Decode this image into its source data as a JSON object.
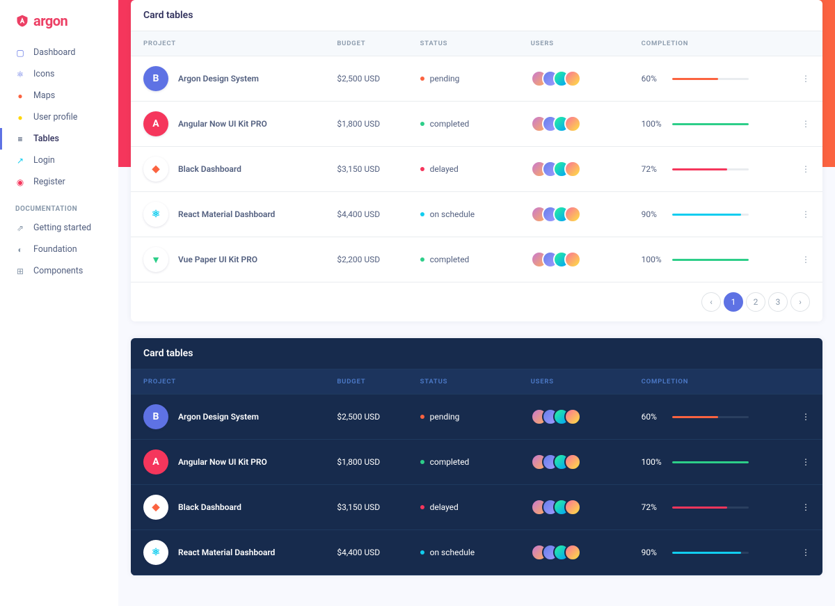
{
  "brand": {
    "name": "argon"
  },
  "sidebar": {
    "items": [
      {
        "label": "Dashboard",
        "icon": "dashboard-icon",
        "color": "#5e72e4"
      },
      {
        "label": "Icons",
        "icon": "atom-icon",
        "color": "#5e72e4"
      },
      {
        "label": "Maps",
        "icon": "pin-icon",
        "color": "#fb6340"
      },
      {
        "label": "User profile",
        "icon": "user-icon",
        "color": "#ffd600"
      },
      {
        "label": "Tables",
        "icon": "list-icon",
        "color": "#172b4d",
        "active": true
      },
      {
        "label": "Login",
        "icon": "key-icon",
        "color": "#11cdef"
      },
      {
        "label": "Register",
        "icon": "circle-icon",
        "color": "#f5365c"
      }
    ],
    "doc_heading": "DOCUMENTATION",
    "docs": [
      {
        "label": "Getting started",
        "icon": "rocket-icon"
      },
      {
        "label": "Foundation",
        "icon": "palette-icon"
      },
      {
        "label": "Components",
        "icon": "grid-icon"
      }
    ]
  },
  "tables": {
    "light": {
      "title": "Card tables",
      "columns": [
        "PROJECT",
        "BUDGET",
        "STATUS",
        "USERS",
        "COMPLETION",
        ""
      ],
      "rows": [
        {
          "name": "Argon Design System",
          "budget": "$2,500 USD",
          "status": "pending",
          "status_color": "#fb6340",
          "completion": 60,
          "bar_color": "#fb6340",
          "logo_bg": "#5e72e4",
          "logo_text": "B",
          "logo_fg": "#fff"
        },
        {
          "name": "Angular Now UI Kit PRO",
          "budget": "$1,800 USD",
          "status": "completed",
          "status_color": "#2dce89",
          "completion": 100,
          "bar_color": "#2dce89",
          "logo_bg": "#f5365c",
          "logo_text": "A",
          "logo_fg": "#fff"
        },
        {
          "name": "Black Dashboard",
          "budget": "$3,150 USD",
          "status": "delayed",
          "status_color": "#f5365c",
          "completion": 72,
          "bar_color": "#f5365c",
          "logo_bg": "#fff",
          "logo_text": "◆",
          "logo_fg": "#fb6340"
        },
        {
          "name": "React Material Dashboard",
          "budget": "$4,400 USD",
          "status": "on schedule",
          "status_color": "#11cdef",
          "completion": 90,
          "bar_color": "#11cdef",
          "logo_bg": "#fff",
          "logo_text": "⚛",
          "logo_fg": "#11cdef"
        },
        {
          "name": "Vue Paper UI Kit PRO",
          "budget": "$2,200 USD",
          "status": "completed",
          "status_color": "#2dce89",
          "completion": 100,
          "bar_color": "#2dce89",
          "logo_bg": "#fff",
          "logo_text": "▼",
          "logo_fg": "#2dce89"
        }
      ],
      "pagination": {
        "pages": [
          "1",
          "2",
          "3"
        ],
        "active": 1
      }
    },
    "dark": {
      "title": "Card tables",
      "columns": [
        "PROJECT",
        "BUDGET",
        "STATUS",
        "USERS",
        "COMPLETION",
        ""
      ],
      "rows": [
        {
          "name": "Argon Design System",
          "budget": "$2,500 USD",
          "status": "pending",
          "status_color": "#fb6340",
          "completion": 60,
          "bar_color": "#fb6340",
          "logo_bg": "#5e72e4",
          "logo_text": "B",
          "logo_fg": "#fff"
        },
        {
          "name": "Angular Now UI Kit PRO",
          "budget": "$1,800 USD",
          "status": "completed",
          "status_color": "#2dce89",
          "completion": 100,
          "bar_color": "#2dce89",
          "logo_bg": "#f5365c",
          "logo_text": "A",
          "logo_fg": "#fff"
        },
        {
          "name": "Black Dashboard",
          "budget": "$3,150 USD",
          "status": "delayed",
          "status_color": "#f5365c",
          "completion": 72,
          "bar_color": "#f5365c",
          "logo_bg": "#fff",
          "logo_text": "◆",
          "logo_fg": "#fb6340"
        },
        {
          "name": "React Material Dashboard",
          "budget": "$4,400 USD",
          "status": "on schedule",
          "status_color": "#11cdef",
          "completion": 90,
          "bar_color": "#11cdef",
          "logo_bg": "#fff",
          "logo_text": "⚛",
          "logo_fg": "#11cdef"
        }
      ]
    }
  }
}
